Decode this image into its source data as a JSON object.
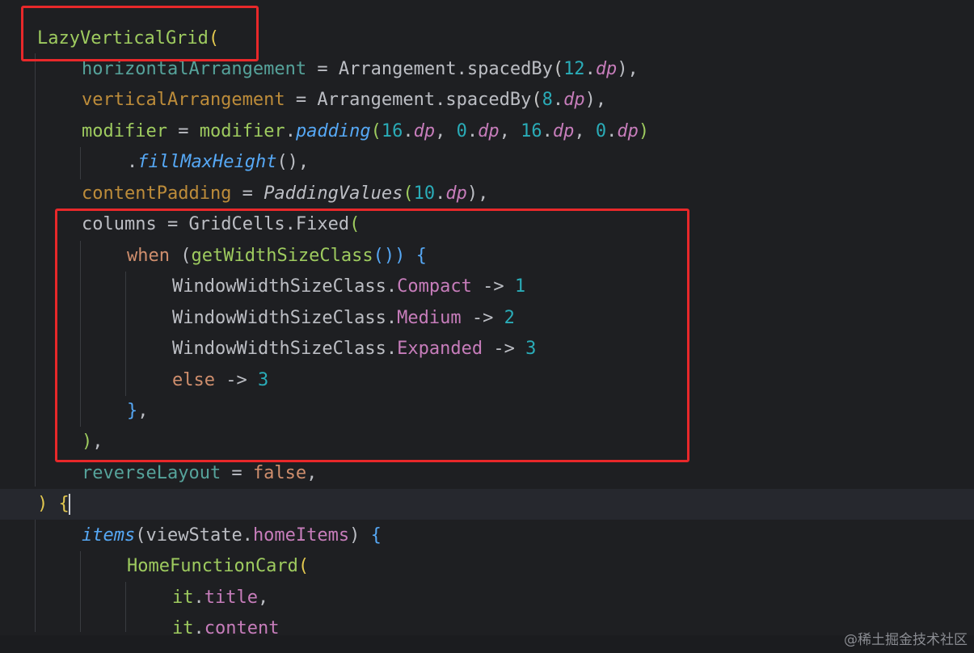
{
  "editor": {
    "colors": {
      "background": "#1e1f22",
      "default": "#bcbec4",
      "function": "#56a8f5",
      "param": "#c77dbb",
      "keyword": "#cf8e6d",
      "number": "#2aacb8",
      "constructor": "#57aa63",
      "property": "#c77dbb",
      "highlight_box": "#e8282a"
    },
    "lines": [
      {
        "tokens": [
          {
            "t": "LazyVerticalGrid",
            "c": "#9ecb5f"
          },
          {
            "t": "(",
            "c": "#e3c84f"
          }
        ]
      },
      {
        "tokens": [
          {
            "t": "horizontalArrangement",
            "c": "#56a39b"
          },
          {
            "t": " = ",
            "c": "#bcbec4"
          },
          {
            "t": "Arrangement.spacedBy",
            "c": "#bcbec4"
          },
          {
            "t": "(",
            "c": "#c7c7c7"
          },
          {
            "t": "12",
            "c": "#2aacb8"
          },
          {
            "t": ".",
            "c": "#bcbec4"
          },
          {
            "t": "dp",
            "c": "#c77dbb",
            "i": true
          },
          {
            "t": "),",
            "c": "#bcbec4"
          }
        ]
      },
      {
        "tokens": [
          {
            "t": "verticalArrangement",
            "c": "#bd8c3a"
          },
          {
            "t": " = ",
            "c": "#bcbec4"
          },
          {
            "t": "Arrangement.spacedBy",
            "c": "#bcbec4"
          },
          {
            "t": "(",
            "c": "#c7c7c7"
          },
          {
            "t": "8",
            "c": "#2aacb8"
          },
          {
            "t": ".",
            "c": "#bcbec4"
          },
          {
            "t": "dp",
            "c": "#c77dbb",
            "i": true
          },
          {
            "t": "),",
            "c": "#bcbec4"
          }
        ]
      },
      {
        "tokens": [
          {
            "t": "modifier",
            "c": "#9ecb5f"
          },
          {
            "t": " = ",
            "c": "#bcbec4"
          },
          {
            "t": "modifier",
            "c": "#9ecb5f"
          },
          {
            "t": ".",
            "c": "#bcbec4"
          },
          {
            "t": "padding",
            "c": "#56a8f5",
            "i": true
          },
          {
            "t": "(",
            "c": "#9ecb5f"
          },
          {
            "t": "16",
            "c": "#2aacb8"
          },
          {
            "t": ".",
            "c": "#bcbec4"
          },
          {
            "t": "dp",
            "c": "#c77dbb",
            "i": true
          },
          {
            "t": ", ",
            "c": "#bcbec4"
          },
          {
            "t": "0",
            "c": "#2aacb8"
          },
          {
            "t": ".",
            "c": "#bcbec4"
          },
          {
            "t": "dp",
            "c": "#c77dbb",
            "i": true
          },
          {
            "t": ", ",
            "c": "#bcbec4"
          },
          {
            "t": "16",
            "c": "#2aacb8"
          },
          {
            "t": ".",
            "c": "#bcbec4"
          },
          {
            "t": "dp",
            "c": "#c77dbb",
            "i": true
          },
          {
            "t": ", ",
            "c": "#bcbec4"
          },
          {
            "t": "0",
            "c": "#2aacb8"
          },
          {
            "t": ".",
            "c": "#bcbec4"
          },
          {
            "t": "dp",
            "c": "#c77dbb",
            "i": true
          },
          {
            "t": ")",
            "c": "#9ecb5f"
          }
        ]
      },
      {
        "tokens": [
          {
            "t": ".",
            "c": "#bcbec4"
          },
          {
            "t": "fillMaxHeight",
            "c": "#56a8f5",
            "i": true
          },
          {
            "t": "(),",
            "c": "#bcbec4"
          }
        ]
      },
      {
        "tokens": [
          {
            "t": "contentPadding",
            "c": "#bd8c3a"
          },
          {
            "t": " = ",
            "c": "#bcbec4"
          },
          {
            "t": "PaddingValues",
            "c": "#bcbec4",
            "i": true
          },
          {
            "t": "(",
            "c": "#9ecb5f"
          },
          {
            "t": "10",
            "c": "#2aacb8"
          },
          {
            "t": ".",
            "c": "#bcbec4"
          },
          {
            "t": "dp",
            "c": "#c77dbb",
            "i": true
          },
          {
            "t": "),",
            "c": "#bcbec4"
          }
        ]
      },
      {
        "tokens": [
          {
            "t": "columns",
            "c": "#bcbec4"
          },
          {
            "t": " = ",
            "c": "#bcbec4"
          },
          {
            "t": "GridCells.Fixed",
            "c": "#bcbec4"
          },
          {
            "t": "(",
            "c": "#9ecb5f"
          }
        ]
      },
      {
        "tokens": [
          {
            "t": "when",
            "c": "#cf8e6d"
          },
          {
            "t": " (",
            "c": "#bcbec4"
          },
          {
            "t": "getWidthSizeClass",
            "c": "#9ecb5f"
          },
          {
            "t": "()) {",
            "c": "#56a8f5"
          }
        ]
      },
      {
        "tokens": [
          {
            "t": "WindowWidthSizeClass.",
            "c": "#bcbec4"
          },
          {
            "t": "Compact",
            "c": "#c77dbb"
          },
          {
            "t": " -> ",
            "c": "#bcbec4"
          },
          {
            "t": "1",
            "c": "#2aacb8"
          }
        ]
      },
      {
        "tokens": [
          {
            "t": "WindowWidthSizeClass.",
            "c": "#bcbec4"
          },
          {
            "t": "Medium",
            "c": "#c77dbb"
          },
          {
            "t": " -> ",
            "c": "#bcbec4"
          },
          {
            "t": "2",
            "c": "#2aacb8"
          }
        ]
      },
      {
        "tokens": [
          {
            "t": "WindowWidthSizeClass.",
            "c": "#bcbec4"
          },
          {
            "t": "Expanded",
            "c": "#c77dbb"
          },
          {
            "t": " -> ",
            "c": "#bcbec4"
          },
          {
            "t": "3",
            "c": "#2aacb8"
          }
        ]
      },
      {
        "tokens": [
          {
            "t": "else",
            "c": "#cf8e6d"
          },
          {
            "t": " -> ",
            "c": "#bcbec4"
          },
          {
            "t": "3",
            "c": "#2aacb8"
          }
        ]
      },
      {
        "tokens": [
          {
            "t": "}",
            "c": "#56a8f5"
          },
          {
            "t": ",",
            "c": "#bcbec4"
          }
        ]
      },
      {
        "tokens": [
          {
            "t": ")",
            "c": "#9ecb5f"
          },
          {
            "t": ",",
            "c": "#bcbec4"
          }
        ]
      },
      {
        "tokens": [
          {
            "t": "reverseLayout",
            "c": "#56a39b"
          },
          {
            "t": " = ",
            "c": "#bcbec4"
          },
          {
            "t": "false",
            "c": "#cf8e6d"
          },
          {
            "t": ",",
            "c": "#bcbec4"
          }
        ]
      },
      {
        "tokens": [
          {
            "t": ") ",
            "c": "#e3c84f"
          },
          {
            "t": "{",
            "c": "#e3c84f"
          }
        ]
      },
      {
        "tokens": [
          {
            "t": "items",
            "c": "#56a8f5",
            "i": true
          },
          {
            "t": "(viewState.",
            "c": "#bcbec4"
          },
          {
            "t": "homeItems",
            "c": "#c77dbb"
          },
          {
            "t": ") ",
            "c": "#bcbec4"
          },
          {
            "t": "{",
            "c": "#56a8f5"
          }
        ]
      },
      {
        "tokens": [
          {
            "t": "HomeFunctionCard",
            "c": "#9ecb5f"
          },
          {
            "t": "(",
            "c": "#e3c84f"
          }
        ]
      },
      {
        "tokens": [
          {
            "t": "it",
            "c": "#9ecb5f"
          },
          {
            "t": ".",
            "c": "#bcbec4"
          },
          {
            "t": "title",
            "c": "#c77dbb"
          },
          {
            "t": ",",
            "c": "#bcbec4"
          }
        ]
      },
      {
        "tokens": [
          {
            "t": "it",
            "c": "#9ecb5f"
          },
          {
            "t": ".",
            "c": "#bcbec4"
          },
          {
            "t": "content",
            "c": "#c77dbb"
          }
        ]
      }
    ]
  },
  "watermark": "@稀土掘金技术社区"
}
